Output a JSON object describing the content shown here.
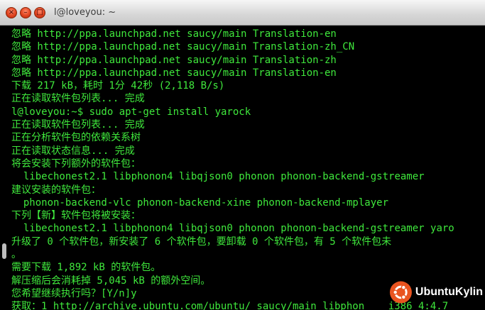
{
  "window": {
    "title": "l@loveyou: ~"
  },
  "terminal": {
    "lines": [
      "忽略 http://ppa.launchpad.net saucy/main Translation-en",
      "忽略 http://ppa.launchpad.net saucy/main Translation-zh_CN",
      "忽略 http://ppa.launchpad.net saucy/main Translation-zh",
      "忽略 http://ppa.launchpad.net saucy/main Translation-en",
      "下载 217 kB，耗时 1分 42秒 (2,118 B/s)",
      "正在读取软件包列表... 完成",
      "l@loveyou:~$ sudo apt-get install yarock",
      "正在读取软件包列表... 完成",
      "正在分析软件包的依赖关系树",
      "正在读取状态信息... 完成",
      "将会安装下列额外的软件包：",
      "  libechonest2.1 libphonon4 libqjson0 phonon phonon-backend-gstreamer",
      "建议安装的软件包：",
      "  phonon-backend-vlc phonon-backend-xine phonon-backend-mplayer",
      "下列【新】软件包将被安装：",
      "  libechonest2.1 libphonon4 libqjson0 phonon phonon-backend-gstreamer yaro",
      "升级了 0 个软件包，新安装了 6 个软件包，要卸载 0 个软件包，有 5 个软件包未",
      "。",
      "需要下载 1,892 kB 的软件包。",
      "解压缩后会消耗掉 5,045 kB 的额外空间。",
      "您希望继续执行吗？[Y/n]y",
      "获取：1 http://archive.ubuntu.com/ubuntu/ saucy/main libphon    i386 4:4.7"
    ]
  },
  "watermark": {
    "text": "UbuntuKylin",
    "color": "#e95420"
  },
  "colors": {
    "terminal_text": "#3fe83c",
    "terminal_bg": "#000000"
  }
}
